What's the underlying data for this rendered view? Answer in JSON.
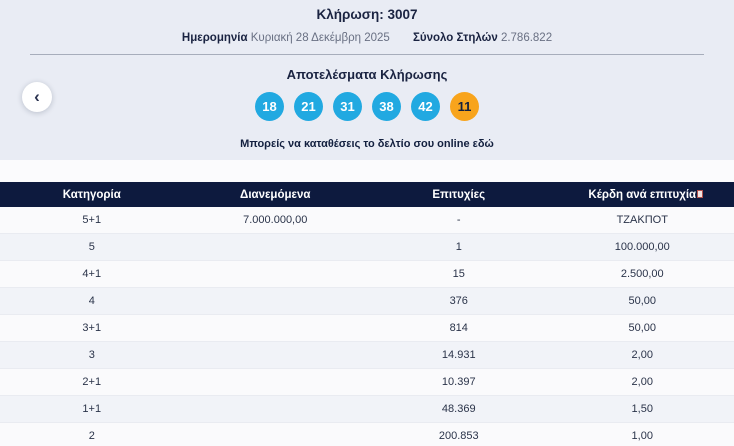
{
  "summary": {
    "draw_title": "Κλήρωση: 3007",
    "date_label": "Ημερομηνία",
    "date_value": "Κυριακή 28 Δεκέμβρη 2025",
    "total_columns_label": "Σύνολο Στηλών",
    "total_columns_value": "2.786.822"
  },
  "results": {
    "title": "Αποτελέσματα Κλήρωσης",
    "numbers": [
      {
        "value": "18",
        "type": "main"
      },
      {
        "value": "21",
        "type": "main"
      },
      {
        "value": "31",
        "type": "main"
      },
      {
        "value": "38",
        "type": "main"
      },
      {
        "value": "42",
        "type": "main"
      },
      {
        "value": "11",
        "type": "joker"
      }
    ],
    "online_text": "Μπορείς να καταθέσεις το δελτίο σου online εδώ"
  },
  "colors": {
    "ball_main": "#21a9e1",
    "ball_joker": "#f8a41c",
    "table_header_bg": "#0d1a3e"
  },
  "table": {
    "headers": [
      "Κατηγορία",
      "Διανεμόμενα",
      "Επιτυχίες",
      "Κέρδη ανά επιτυχία"
    ],
    "rows": [
      {
        "category": "5+1",
        "distributed": "7.000.000,00",
        "winners": "-",
        "prize": "ΤΖΑΚΠΟΤ"
      },
      {
        "category": "5",
        "distributed": "",
        "winners": "1",
        "prize": "100.000,00"
      },
      {
        "category": "4+1",
        "distributed": "",
        "winners": "15",
        "prize": "2.500,00"
      },
      {
        "category": "4",
        "distributed": "",
        "winners": "376",
        "prize": "50,00"
      },
      {
        "category": "3+1",
        "distributed": "",
        "winners": "814",
        "prize": "50,00"
      },
      {
        "category": "3",
        "distributed": "",
        "winners": "14.931",
        "prize": "2,00"
      },
      {
        "category": "2+1",
        "distributed": "",
        "winners": "10.397",
        "prize": "2,00"
      },
      {
        "category": "1+1",
        "distributed": "",
        "winners": "48.369",
        "prize": "1,50"
      },
      {
        "category": "2",
        "distributed": "",
        "winners": "200.853",
        "prize": "1,00"
      }
    ]
  }
}
